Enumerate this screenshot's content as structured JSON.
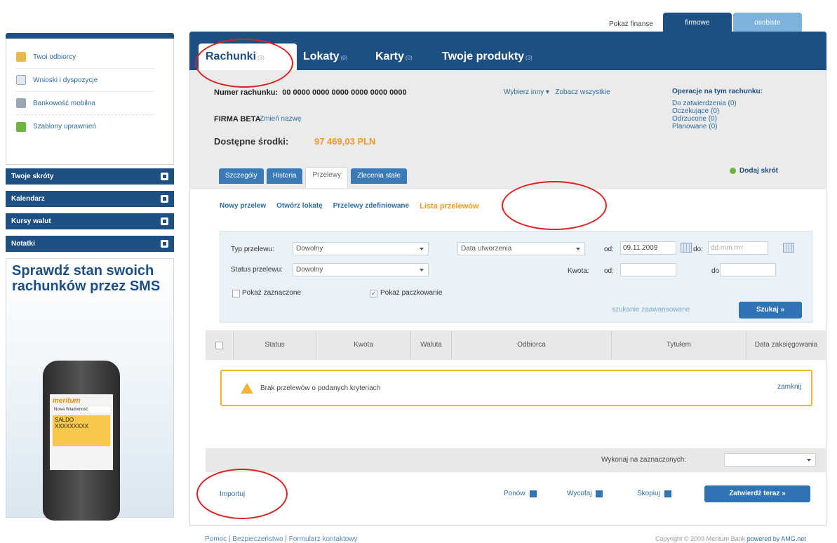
{
  "top_switch": {
    "label": "Pokaż finanse",
    "tabs": [
      "firmowe",
      "osobiste"
    ]
  },
  "sidebar": {
    "links": [
      "Twoi odbiorcy",
      "Wnioski i dyspozycje",
      "Bankowość mobilna",
      "Szablony uprawnień"
    ],
    "sections": [
      "Twoje skróty",
      "Kalendarz",
      "Kursy walut",
      "Notatki"
    ],
    "promo_title": "Sprawdź stan swoich rachunków przez SMS",
    "phone": {
      "brand": "meritum",
      "msg": "Nowa Wiadomość",
      "saldo": "SALDO XXXXXXXXX"
    }
  },
  "main_tabs": [
    {
      "label": "Rachunki",
      "count": "(3)"
    },
    {
      "label": "Lokaty",
      "count": "(0)"
    },
    {
      "label": "Karty",
      "count": "(0)"
    },
    {
      "label": "Twoje produkty",
      "count": "(3)"
    }
  ],
  "account": {
    "number_label": "Numer rachunku:",
    "number": "00 0000 0000 0000 0000 0000 0000",
    "choose_other": "Wybierz inny ▾",
    "see_all": "Zobacz wszystkie",
    "name": "FIRMA BETA",
    "rename": "Zmień nazwę",
    "balance_label": "Dostępne środki:",
    "balance": "97 469,03 PLN"
  },
  "operations": {
    "title": "Operacje na tym rachunku:",
    "items": [
      "Do zatwierdzenia (0)",
      "Oczekujące (0)",
      "Odrzucone (0)",
      "Planowane (0)"
    ]
  },
  "subtabs": [
    "Szczegóły",
    "Historia",
    "Przelewy",
    "Zlecenia stałe"
  ],
  "add_shortcut": "Dodaj skrót",
  "transfer_links": [
    "Nowy przelew",
    "Otwórz lokatę",
    "Przelewy zdefiniowane",
    "Lista przelewów"
  ],
  "filters": {
    "type_label": "Typ przelewu:",
    "type_value": "Dowolny",
    "date_type_value": "Data utworzenia",
    "from_label": "od:",
    "from_date": "09.11.2009",
    "to_label": "do:",
    "to_placeholder": "dd.mm.rrrr",
    "status_label": "Status przelewu:",
    "status_value": "Dowolny",
    "amount_label": "Kwota:",
    "amount_from": "od:",
    "amount_to": "do:",
    "show_marked": "Pokaż zaznaczone",
    "show_grouping": "Pokaż paczkowanie",
    "advanced": "szukanie zaawansowane",
    "search": "Szukaj »"
  },
  "table": {
    "columns": [
      "Status",
      "Kwota",
      "Waluta",
      "Odbiorca",
      "Tytułem",
      "Data zaksięgowania"
    ],
    "empty_message": "Brak przelewów o podanych kryteriach",
    "close": "zamknij"
  },
  "bottom": {
    "execute_label": "Wykonaj na zaznaczonych:",
    "import": "Importuj",
    "actions": [
      "Ponów",
      "Wycofaj",
      "Skopiuj"
    ],
    "confirm": "Zatwierdź teraz »"
  },
  "footer": {
    "links": "Pomoc | Bezpieczeństwo | Formularz kontaktowy",
    "copyright": "Copyright © 2009 Meritum Bank",
    "powered": "powered by AMG.net"
  }
}
